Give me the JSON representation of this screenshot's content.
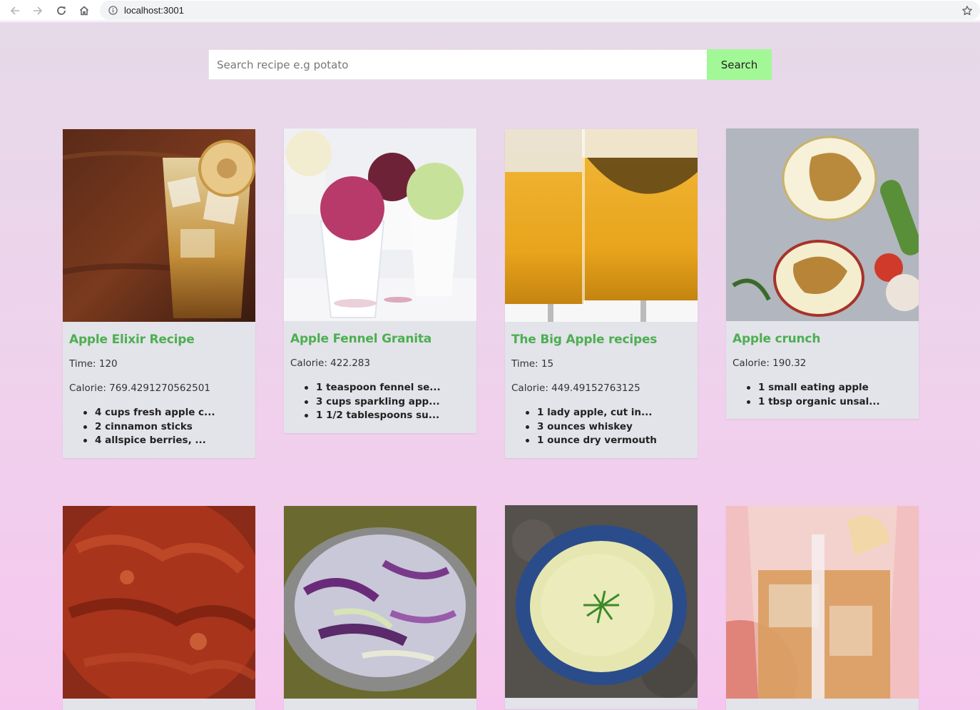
{
  "browser": {
    "url": "localhost:3001",
    "icons": [
      "back-arrow-icon",
      "forward-arrow-icon",
      "reload-icon",
      "home-icon",
      "info-icon",
      "star-icon"
    ]
  },
  "search": {
    "placeholder": "Search recipe e.g potato",
    "value": "",
    "button_label": "Search",
    "button_color": "#a2f896"
  },
  "colors": {
    "title_green": "#4caf50",
    "card_bg": "#e3e3ea"
  },
  "recipes": [
    {
      "title": "Apple Elixir Recipe",
      "time": "Time: 120",
      "calorie": "Calorie: 769.4291270562501",
      "ingredients": [
        "4 cups fresh apple c...",
        "2 cinnamon sticks",
        "4 allspice berries, ..."
      ]
    },
    {
      "title": "Apple Fennel Granita",
      "calorie": "Calorie: 422.283",
      "ingredients": [
        "1 teaspoon fennel se...",
        "3 cups sparkling app...",
        "1 1/2 tablespoons su..."
      ]
    },
    {
      "title": "The Big Apple recipes",
      "time": "Time: 15",
      "calorie": "Calorie: 449.49152763125",
      "ingredients": [
        "1 lady apple, cut in...",
        "3 ounces whiskey",
        "1 ounce dry vermouth"
      ]
    },
    {
      "title": "Apple crunch",
      "calorie": "Calorie: 190.32",
      "ingredients": [
        "1 small eating apple",
        "1 tbsp organic unsal..."
      ]
    }
  ]
}
